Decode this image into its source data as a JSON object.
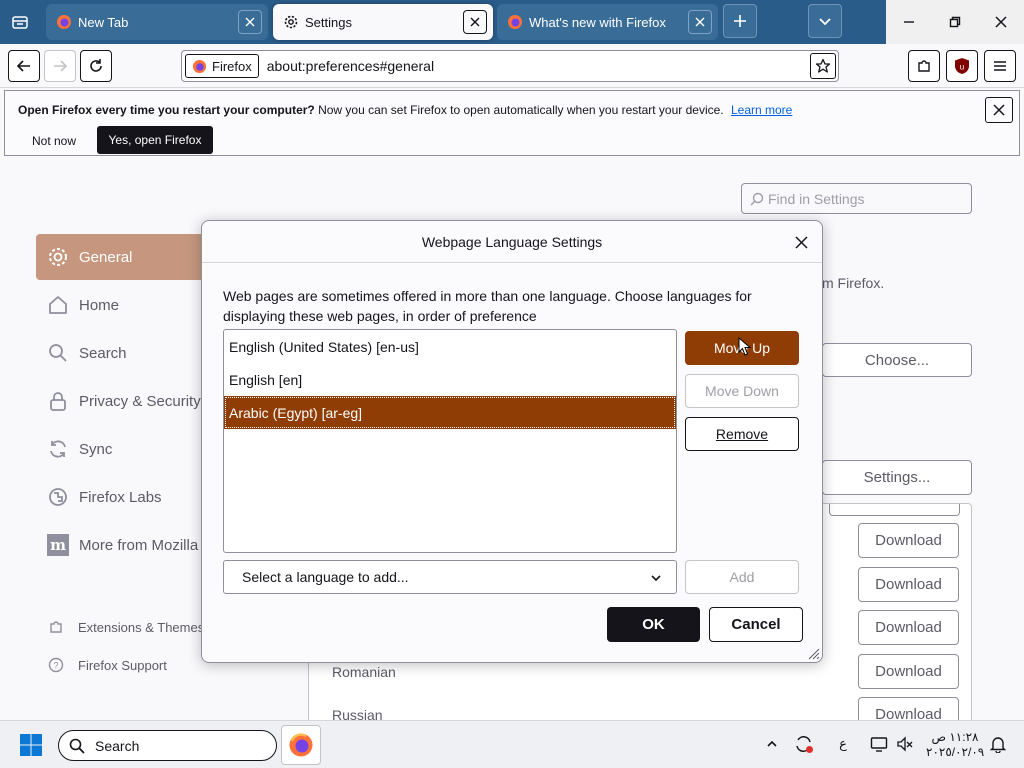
{
  "tabs": [
    {
      "title": "New Tab",
      "active": false
    },
    {
      "title": "Settings",
      "active": true
    },
    {
      "title": "What's new with Firefox",
      "active": false
    }
  ],
  "urlbar": {
    "identity_label": "Firefox",
    "url": "about:preferences#general"
  },
  "notification": {
    "bold_text": "Open Firefox every time you restart your computer?",
    "text": "Now you can set Firefox to open automatically when you restart your device.",
    "link": "Learn more",
    "not_now": "Not now",
    "yes": "Yes, open Firefox"
  },
  "settings": {
    "search_placeholder": "Find in Settings",
    "categories": [
      "General",
      "Home",
      "Search",
      "Privacy & Security",
      "Sync",
      "Firefox Labs",
      "More from Mozilla"
    ],
    "footer_links": [
      "Extensions & Themes",
      "Firefox Support"
    ],
    "background_text": "m Firefox.",
    "choose_button": "Choose...",
    "settings_button": "Settings...",
    "download_label": "Download",
    "languages": [
      "Romanian",
      "Russian"
    ]
  },
  "dialog": {
    "title": "Webpage Language Settings",
    "description": "Web pages are sometimes offered in more than one language. Choose languages for displaying these web pages, in order of preference",
    "languages": [
      {
        "label": "English (United States) [en-us]",
        "selected": false
      },
      {
        "label": "English [en]",
        "selected": false
      },
      {
        "label": "Arabic (Egypt) [ar-eg]",
        "selected": true
      }
    ],
    "move_up": "Move Up",
    "move_down": "Move Down",
    "remove": "Remove",
    "select_placeholder": "Select a language to add...",
    "add": "Add",
    "ok": "OK",
    "cancel": "Cancel"
  },
  "taskbar": {
    "search_label": "Search",
    "tray_lang": "ع",
    "clock_time": "١١:٢٨ ص",
    "clock_date": "٢٠٢٥/٠٢/٠٩"
  },
  "colors": {
    "accent": "#8f3c05",
    "tab_strip": "#2a5c8a",
    "selected_category": "#c6977e"
  }
}
